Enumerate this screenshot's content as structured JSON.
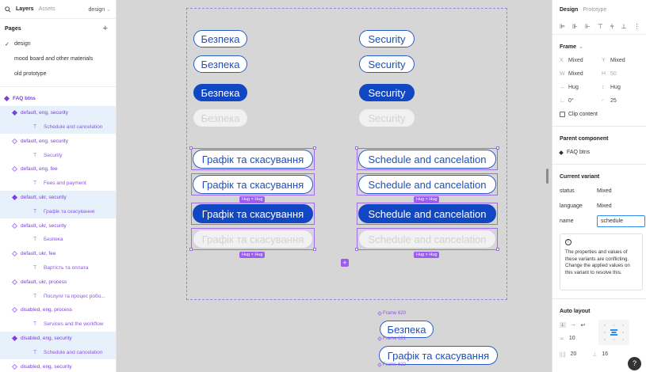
{
  "left_panel": {
    "tabs": {
      "layers": "Layers",
      "assets": "Assets",
      "page": "design"
    },
    "pages_title": "Pages",
    "add_icon": "+",
    "pages": [
      "design",
      "mood board and other materials",
      "old prototype"
    ],
    "layers": [
      {
        "label": "FAQ btns",
        "kind": "top"
      },
      {
        "label": "default, eng, security",
        "kind": "variant-filled",
        "selected": true
      },
      {
        "label": "Schedule and cancelation",
        "kind": "text",
        "selected": true
      },
      {
        "label": "default, eng, security",
        "kind": "variant"
      },
      {
        "label": "Security",
        "kind": "text"
      },
      {
        "label": "default, eng, fee",
        "kind": "variant"
      },
      {
        "label": "Fees and payment",
        "kind": "text"
      },
      {
        "label": "default, ukr, security",
        "kind": "variant-filled",
        "selected": true
      },
      {
        "label": "Графік та скасування",
        "kind": "text",
        "selected": true
      },
      {
        "label": "default, ukr, security",
        "kind": "variant"
      },
      {
        "label": "Безпека",
        "kind": "text"
      },
      {
        "label": "default, ukr, fee",
        "kind": "variant"
      },
      {
        "label": "Вартість та оплата",
        "kind": "text"
      },
      {
        "label": "default, ukr, process",
        "kind": "variant"
      },
      {
        "label": "Послуги та процес робо...",
        "kind": "text"
      },
      {
        "label": "disabled, eng, process",
        "kind": "variant"
      },
      {
        "label": "Services and the workflow",
        "kind": "text"
      },
      {
        "label": "disabled, eng, security",
        "kind": "variant-filled",
        "selected": true
      },
      {
        "label": "Schedule and cancelation",
        "kind": "text",
        "selected": true
      },
      {
        "label": "disabled, eng, security",
        "kind": "variant"
      }
    ]
  },
  "canvas": {
    "uk_security": "Безпека",
    "en_security": "Security",
    "uk_schedule": "Графік та скасування",
    "en_schedule": "Schedule and cancelation",
    "hug_label": "Hug × Hug",
    "add_icon": "+",
    "frame620": "Frame 620",
    "frame621": "Frame 621",
    "frame622": "Frame 622"
  },
  "right_panel": {
    "tabs": {
      "design": "Design",
      "prototype": "Prototype"
    },
    "frame_title": "Frame",
    "x": "X",
    "x_val": "Mixed",
    "y": "Y",
    "y_val": "Mixed",
    "w": "W",
    "w_val": "Mixed",
    "h": "H",
    "h_val": "50",
    "hug_w": "Hug",
    "hug_h": "Hug",
    "rotation": "0°",
    "radius": "25",
    "clip_content": "Clip content",
    "parent_component_title": "Parent component",
    "parent_component": "FAQ btns",
    "current_variant_title": "Current variant",
    "variants": [
      {
        "key": "status",
        "value": "Mixed"
      },
      {
        "key": "language",
        "value": "Mixed"
      }
    ],
    "name_key": "name",
    "name_value": "schedule",
    "warning_icon": "!",
    "warning_text": "The properties and values of these variants are conflicting. Change the applied values on this variant to resolve this.",
    "auto_layout_title": "Auto layout",
    "gap": "10",
    "pad_h": "20",
    "pad_v": "16",
    "help_icon": "?"
  }
}
